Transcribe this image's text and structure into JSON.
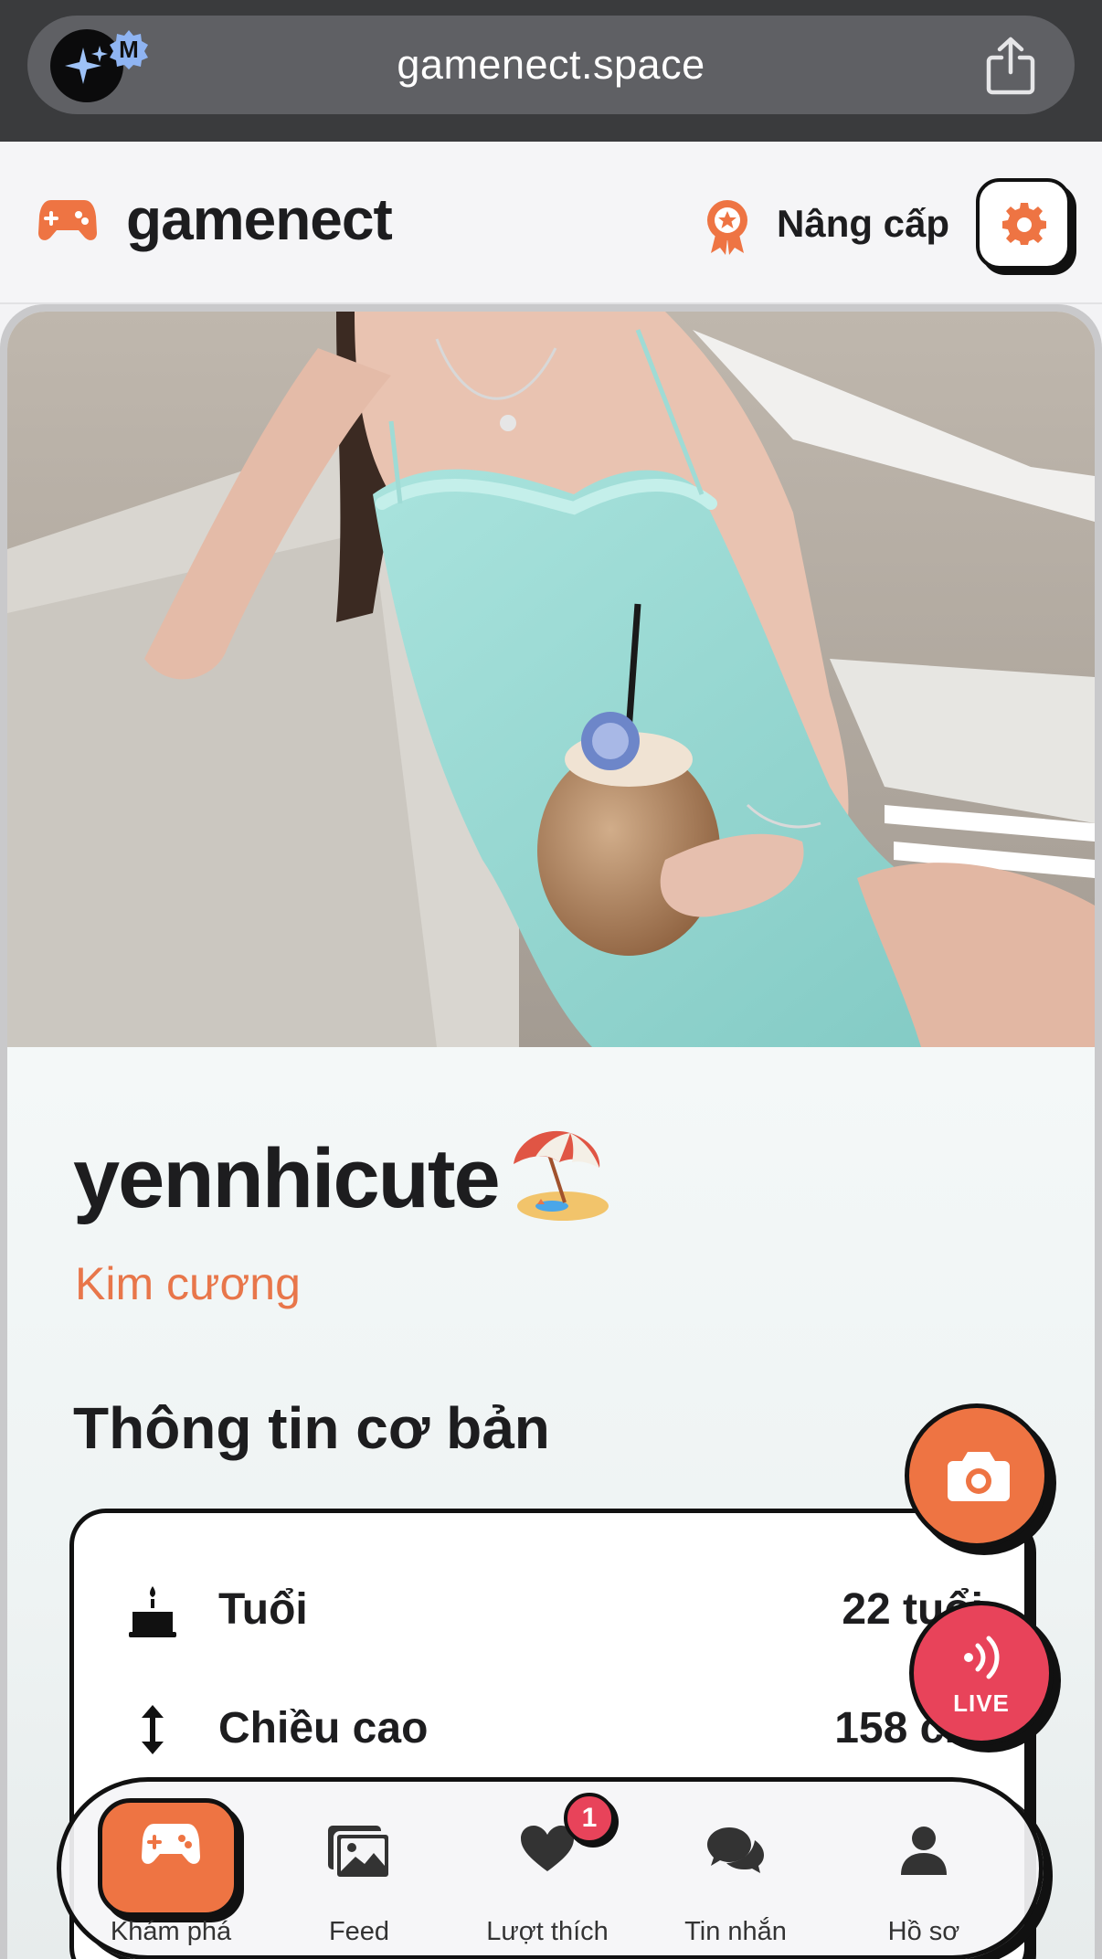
{
  "browser": {
    "url": "gamenect.space",
    "extension_badge": "M",
    "icons": {
      "extension": "sparkle-extension-icon",
      "share": "share-icon"
    }
  },
  "header": {
    "brand": "gamenect",
    "upgrade_label": "Nâng cấp",
    "icons": {
      "logo": "gamepad-icon",
      "upgrade": "award-ribbon-icon",
      "settings": "gear-icon"
    },
    "accent_color": "#ee7443"
  },
  "profile": {
    "photo": "profile-photo",
    "username": "yennhicute",
    "username_emoji": "beach-umbrella-emoji",
    "rank": "Kim cương",
    "section_title": "Thông tin cơ bản",
    "info": [
      {
        "icon": "birthday-cake-icon",
        "label": "Tuổi",
        "value": "22 tuổi"
      },
      {
        "icon": "vertical-arrows-icon",
        "label": "Chiều cao",
        "value": "158 cm"
      }
    ]
  },
  "fabs": {
    "camera": {
      "icon": "camera-icon",
      "color": "#ee7443"
    },
    "live": {
      "icon": "broadcast-icon",
      "label": "LIVE",
      "color": "#e8435a"
    }
  },
  "nav": {
    "items": [
      {
        "label": "Khám phá",
        "icon": "gamepad-icon",
        "active": true
      },
      {
        "label": "Feed",
        "icon": "photos-icon",
        "active": false
      },
      {
        "label": "Lượt thích",
        "icon": "heart-icon",
        "active": false,
        "badge": "1"
      },
      {
        "label": "Tin nhắn",
        "icon": "chat-bubbles-icon",
        "active": false
      },
      {
        "label": "Hồ sơ",
        "icon": "person-icon",
        "active": false
      }
    ]
  }
}
